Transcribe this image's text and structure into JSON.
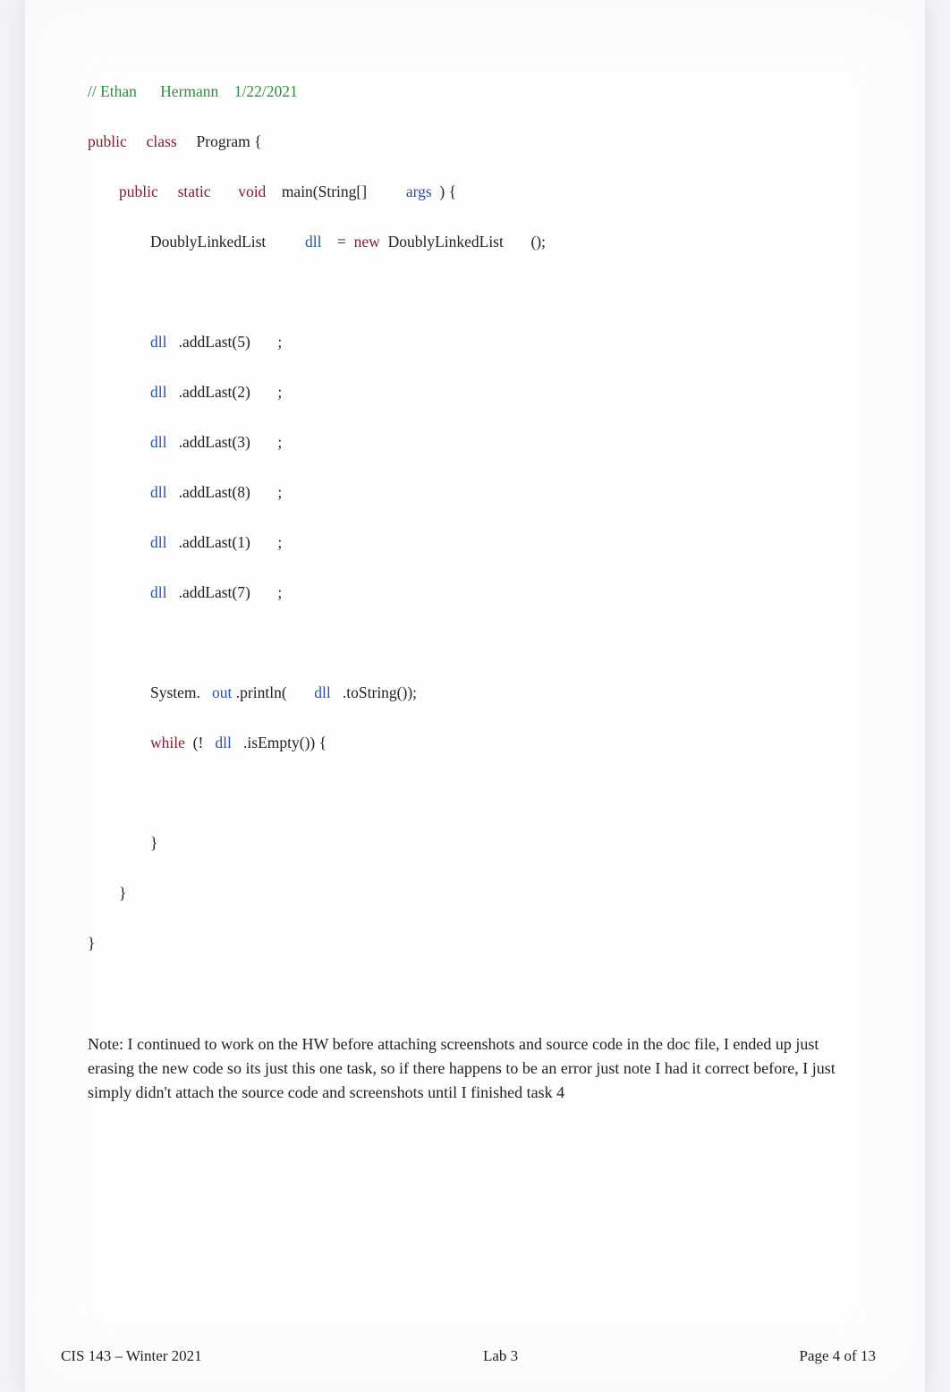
{
  "code": {
    "line1_comment": "// Ethan      Hermann    1/22/2021",
    "line2_a": "public",
    "line2_b": "class",
    "line2_c": "Program {",
    "line3_a": "public",
    "line3_b": "static",
    "line3_c": "void",
    "line3_d": "main(String[]",
    "line3_e": "args",
    "line3_f": ") {",
    "line4_a": "DoublyLinkedList",
    "line4_b": "dll",
    "line4_c": "=",
    "line4_d": "new",
    "line4_e": "DoublyLinkedList",
    "line4_f": "();",
    "line5_a": "dll",
    "line5_b": ".addLast(5)",
    "line5_c": ";",
    "line6_a": "dll",
    "line6_b": ".addLast(2)",
    "line6_c": ";",
    "line7_a": "dll",
    "line7_b": ".addLast(3)",
    "line7_c": ";",
    "line8_a": "dll",
    "line8_b": ".addLast(8)",
    "line8_c": ";",
    "line9_a": "dll",
    "line9_b": ".addLast(1)",
    "line9_c": ";",
    "line10_a": "dll",
    "line10_b": ".addLast(7)",
    "line10_c": ";",
    "line11_a": "System.",
    "line11_b": "out",
    "line11_c": ".println(",
    "line11_d": "dll",
    "line11_e": ".toString());",
    "line12_a": "while",
    "line12_b": "(!",
    "line12_c": "dll",
    "line12_d": ".isEmpty()) {",
    "line13": "}",
    "line14": "}",
    "line15": "}"
  },
  "note_text": "Note: I continued to work on the HW before attaching screenshots and source code in the doc file, I ended up just erasing the new code so its just this one task, so if there happens to be an error just note I had it correct before, I just simply didn't attach the source code and screenshots until I finished task 4",
  "footer": {
    "left": "CIS 143 – Winter 2021",
    "center": "Lab 3",
    "right": "Page 4 of 13"
  }
}
